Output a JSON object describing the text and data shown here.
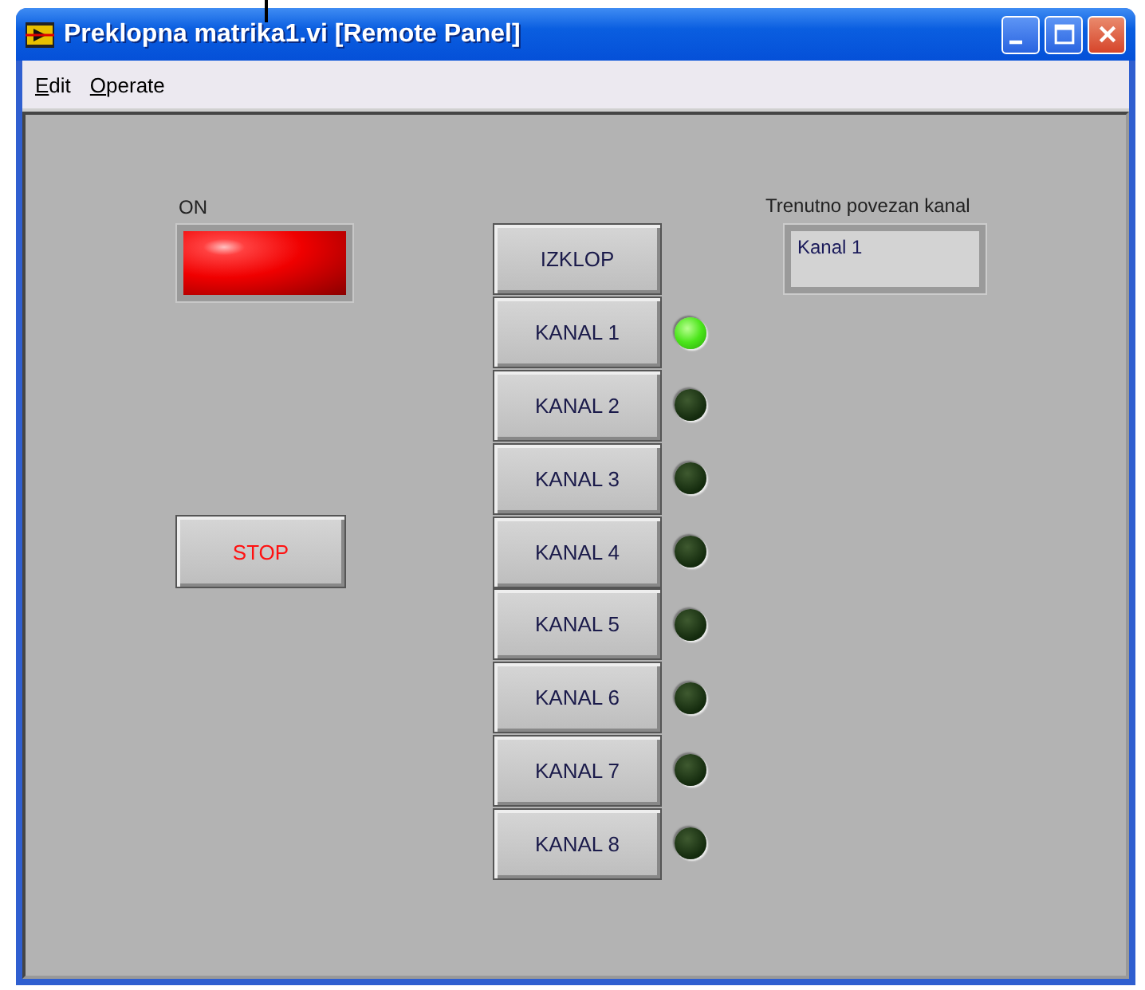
{
  "window": {
    "title": "Preklopna matrika1.vi [Remote Panel]"
  },
  "menu": [
    {
      "mnemonic": "E",
      "rest": "dit"
    },
    {
      "mnemonic": "O",
      "rest": "perate"
    }
  ],
  "on_indicator": {
    "label": "ON",
    "on": true
  },
  "stop_button": {
    "label": "STOP"
  },
  "switches": [
    {
      "kind": "button",
      "label": "IZKLOP"
    },
    {
      "kind": "channel",
      "label": "KANAL 1",
      "on": true
    },
    {
      "kind": "channel",
      "label": "KANAL 2",
      "on": false
    },
    {
      "kind": "channel",
      "label": "KANAL 3",
      "on": false
    },
    {
      "kind": "channel",
      "label": "KANAL 4",
      "on": false
    },
    {
      "kind": "channel",
      "label": "KANAL 5",
      "on": false
    },
    {
      "kind": "channel",
      "label": "KANAL 6",
      "on": false
    },
    {
      "kind": "channel",
      "label": "KANAL 7",
      "on": false
    },
    {
      "kind": "channel",
      "label": "KANAL 8",
      "on": false
    }
  ],
  "channel_display": {
    "label": "Trenutno povezan kanal",
    "value": "Kanal 1"
  }
}
